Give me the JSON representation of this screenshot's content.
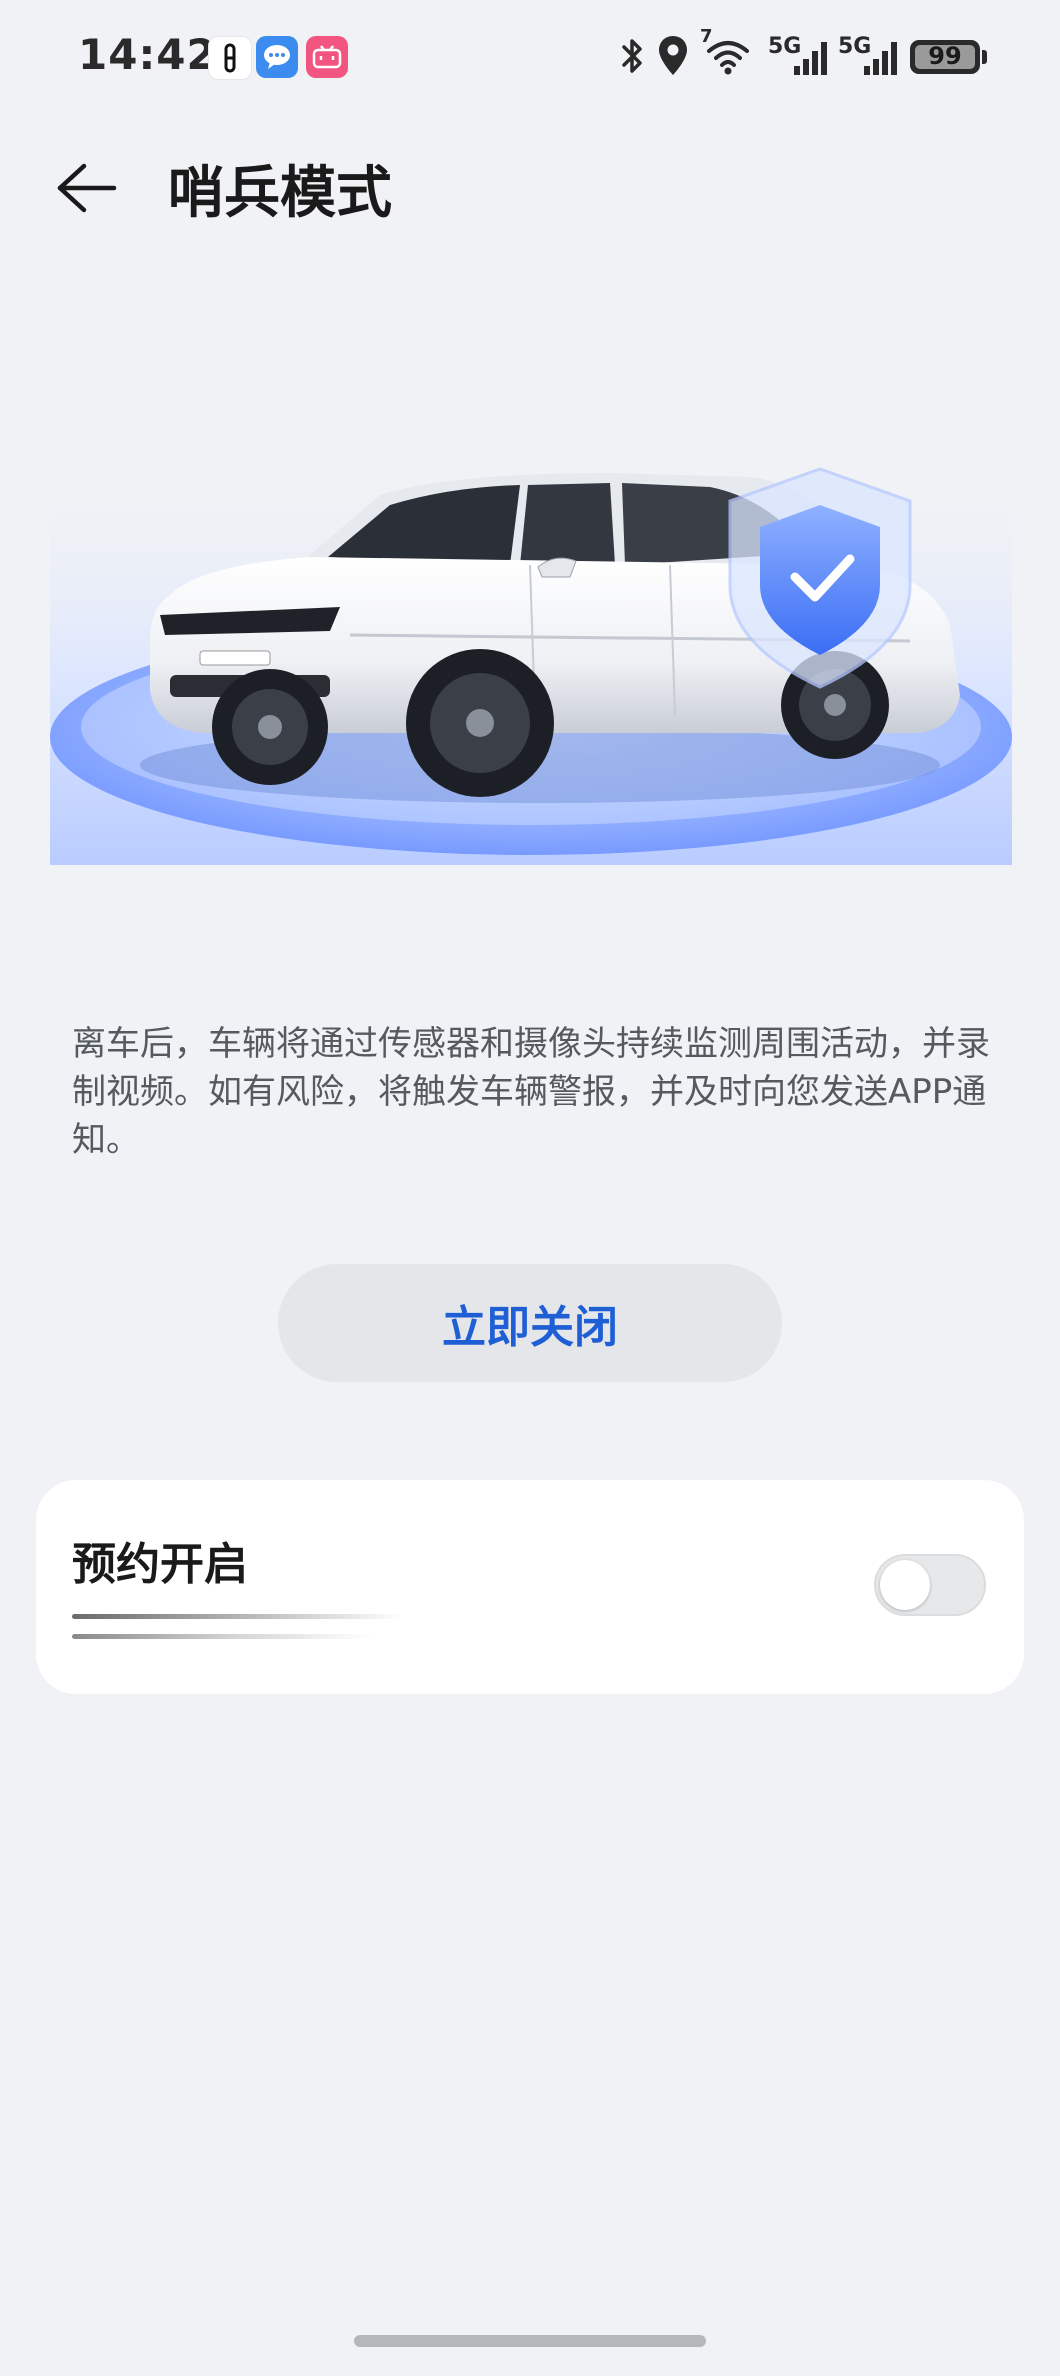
{
  "status_bar": {
    "time": "14:42",
    "network_badge": "7",
    "sim1_label": "5G",
    "sim2_label": "5G",
    "battery_level": "99",
    "icons": [
      "bluetooth-icon",
      "location-icon",
      "wifi-icon",
      "signal-icon",
      "battery-icon"
    ]
  },
  "header": {
    "title": "哨兵模式",
    "back_icon": "arrow-left-icon"
  },
  "hero": {
    "image": "white-suv-with-shield-illustration",
    "shield_icon": "shield-check-icon",
    "colors": {
      "glow": "#7aa3ff",
      "shield": "#3b6ef5"
    }
  },
  "description": {
    "text": "离车后，车辆将通过传感器和摄像头持续监测周围活动，并录制视频。如有风险，将触发车辆警报，并及时向您发送APP通知。"
  },
  "actions": {
    "close_now_label": "立即关闭",
    "accent_color": "#1f5fd6"
  },
  "schedule": {
    "title": "预约开启",
    "toggle_on": false
  }
}
